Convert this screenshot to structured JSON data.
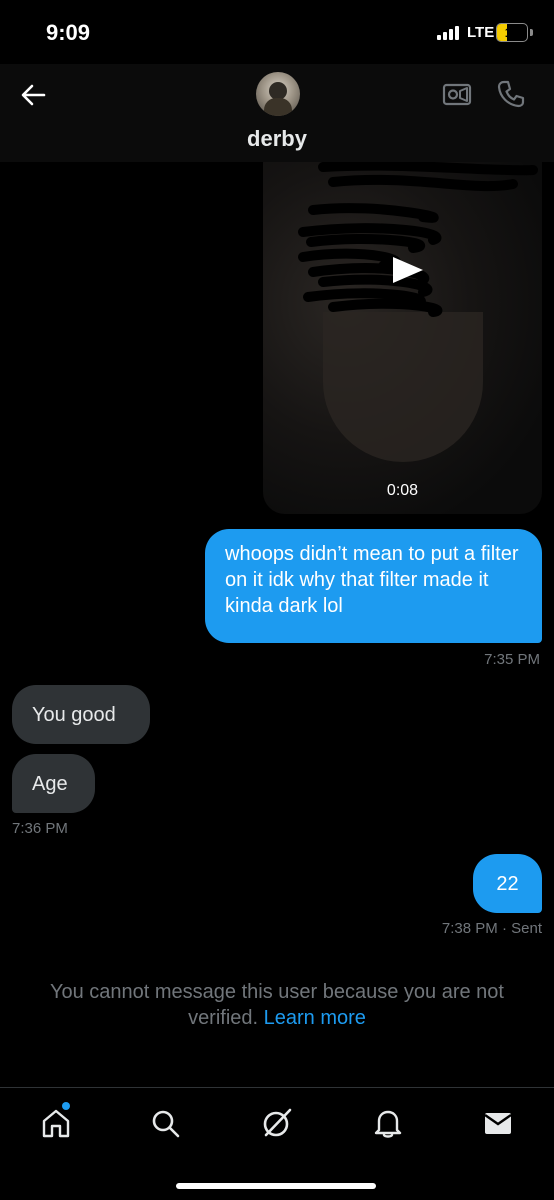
{
  "status_bar": {
    "time": "9:09",
    "network": "LTE",
    "battery": "12"
  },
  "header": {
    "contact_name": "derby",
    "back_icon": "arrow-left-icon",
    "video_icon": "video-camera-icon",
    "call_icon": "phone-icon"
  },
  "messages": {
    "video": {
      "duration": "0:08",
      "icon": "play-icon"
    },
    "sent_1": {
      "text": "whoops didn’t mean to put a filter on it idk why that filter made it kinda dark lol",
      "time": "7:35 PM"
    },
    "received_1": {
      "text": "You good"
    },
    "received_2": {
      "text": "Age",
      "time": "7:36 PM"
    },
    "sent_2": {
      "text": "22",
      "time": "7:38 PM",
      "status": "· Sent"
    }
  },
  "notice": {
    "text": "You cannot message this user because you are not verified.",
    "link": "Learn more"
  },
  "tab_bar": {
    "items": [
      "home-icon",
      "search-icon",
      "grok-icon",
      "bell-icon",
      "mail-icon"
    ]
  },
  "colors": {
    "accent": "#1d9bf0",
    "received_bubble": "#2f3336",
    "background": "#000000",
    "muted_text": "#71767b",
    "battery_low": "#f5cc00"
  }
}
